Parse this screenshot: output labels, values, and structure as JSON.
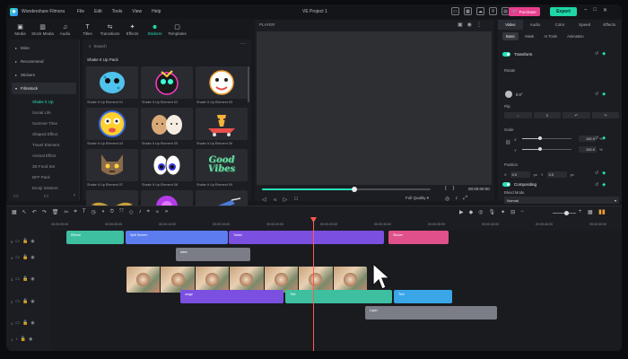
{
  "app": {
    "name": "Wondershare Filmora",
    "project_title": "VE Project 1",
    "menu": [
      "File",
      "Edit",
      "Tools",
      "View",
      "Help"
    ],
    "purchase_label": "Purchase",
    "export_label": "Export"
  },
  "media_tabs": [
    {
      "label": "Media",
      "icon": "media-icon"
    },
    {
      "label": "Stock Media",
      "icon": "stock-media-icon"
    },
    {
      "label": "Audio",
      "icon": "audio-icon"
    },
    {
      "label": "Titles",
      "icon": "titles-icon"
    },
    {
      "label": "Transitions",
      "icon": "transitions-icon"
    },
    {
      "label": "Effects",
      "icon": "effects-icon"
    },
    {
      "label": "Stickers",
      "icon": "stickers-icon",
      "active": true
    },
    {
      "label": "Templates",
      "icon": "templates-icon"
    }
  ],
  "sidebar": {
    "items": [
      {
        "label": "Mine"
      },
      {
        "label": "Recommend"
      },
      {
        "label": "Stickers"
      },
      {
        "label": "Filmstock",
        "highlight": true
      }
    ],
    "subitems": [
      {
        "label": "Shake It Up",
        "active": true
      },
      {
        "label": "Social Life"
      },
      {
        "label": "Summer Time"
      },
      {
        "label": "Shaped Effect"
      },
      {
        "label": "Travel Element"
      },
      {
        "label": "Animal Effect"
      },
      {
        "label": "3D Food Set"
      },
      {
        "label": "BFF Pack"
      },
      {
        "label": "Emoji Stickers"
      }
    ]
  },
  "assets": {
    "search_placeholder": "Search",
    "pack_title": "Shake It Up Pack",
    "items": [
      {
        "label": "Shake It Up Element 01"
      },
      {
        "label": "Shake It Up Element 02"
      },
      {
        "label": "Shake It Up Element 03"
      },
      {
        "label": "Shake It Up Element 04"
      },
      {
        "label": "Shake It Up Element 05"
      },
      {
        "label": "Shake It Up Element 06"
      },
      {
        "label": "Shake It Up Element 07"
      },
      {
        "label": "Shake It Up Element 08"
      },
      {
        "label": "Shake It Up Element 09"
      },
      {
        "label": ""
      },
      {
        "label": ""
      },
      {
        "label": ""
      }
    ],
    "sticker_text_09": "Good Vibes"
  },
  "player": {
    "label": "PLAYER",
    "time": "00:00:00:00",
    "quality": "Full Quality",
    "progress": 0.55
  },
  "properties": {
    "tabs": [
      "Video",
      "Audio",
      "Color",
      "Speed",
      "Effects"
    ],
    "active_tab": "Video",
    "subtabs": [
      "Basic",
      "Mask",
      "AI Tools",
      "Animation"
    ],
    "active_subtab": "Basic",
    "transform_label": "Transform",
    "rotate_label": "Rotate",
    "rotate_value": "0.0°",
    "flip_label": "Flip",
    "scale_label": "Scale",
    "scale_x_label": "X",
    "scale_x_value": "100.0",
    "scale_y_label": "Y",
    "scale_y_value": "100.0",
    "scale_unit": "%",
    "position_label": "Position",
    "pos_x_label": "X",
    "pos_x_value": "0.0",
    "pos_x_unit": "px",
    "pos_y_label": "Y",
    "pos_y_value": "0.0",
    "pos_y_unit": "px",
    "compositing_label": "Compositing",
    "blend_mode_label": "Blend Mode",
    "blend_mode_value": "Normal"
  },
  "timeline": {
    "ruler_labels": [
      "00:00:00:00",
      "00:00:05:00",
      "00:00:10:00",
      "00:00:15:00",
      "00:00:20:00",
      "00:00:25:00",
      "00:00:30:00",
      "00:00:35:00",
      "00:00:40:00",
      "00:00:45:00",
      "00:00:50:00"
    ],
    "track_numbers": [
      "5",
      "4",
      "3",
      "2",
      "1",
      "1"
    ],
    "clips": [
      {
        "label": "Effects",
        "color": "#3dbfa0"
      },
      {
        "label": "Split Screen",
        "color": "#5c7cf0"
      },
      {
        "label": "Tablet",
        "color": "#7b4fe0"
      },
      {
        "label": "Sticker",
        "color": "#e0508a"
      },
      {
        "label": "label",
        "color": "#7a7d86"
      },
      {
        "label": "mage",
        "color": "#7b4fe0"
      },
      {
        "label": "Title",
        "color": "#3dbfa0"
      },
      {
        "label": "Text",
        "color": "#3aa6e8"
      },
      {
        "label": "Layer",
        "color": "#7a7d86"
      }
    ]
  }
}
